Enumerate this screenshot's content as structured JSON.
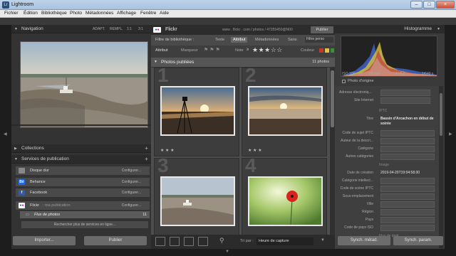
{
  "window": {
    "title": "Lightroom",
    "min": "–",
    "max": "□",
    "close": "×"
  },
  "menu": [
    "Fichier",
    "Édition",
    "Bibliothèque",
    "Photo",
    "Métadonnées",
    "Affichage",
    "Fenêtre",
    "Aide"
  ],
  "navigator": {
    "title": "Navigation",
    "options": [
      "ADAPT.",
      "REMPL.",
      "1:1",
      "3:1"
    ]
  },
  "collections": {
    "title": "Collections",
    "add": "+"
  },
  "publish": {
    "title": "Services de publication",
    "add": "+",
    "services": [
      {
        "icon": "",
        "name": "Disque dur",
        "action": "Configurer..."
      },
      {
        "icon": "Bē",
        "name": "Behance",
        "action": "Configurer..."
      },
      {
        "icon": "f",
        "name": "Facebook",
        "action": "Configurer..."
      },
      {
        "icon": "••",
        "name": "Flickr",
        "sub": ": ma publication",
        "action": "Configurer..."
      }
    ],
    "photostream": {
      "name": "Flux de photos",
      "count": "11"
    },
    "find_more": "Rechercher plus de services en ligne..."
  },
  "left_buttons": {
    "import": "Importer...",
    "publish": "Publier"
  },
  "center": {
    "service_title": "Flickr",
    "url": "www . flickr . com / photos / 47355450@N00",
    "publish_btn": "Publier",
    "filter_label": "Filtre de bibliothèque :",
    "filter_tabs": [
      "Texte",
      "Attribut",
      "Métadonnées",
      "Sans"
    ],
    "preset": "Filtre perso",
    "attribute_label": "Attribut",
    "flag_label": "Marqueur",
    "rating_label": "Note",
    "rating_op": "≥",
    "rating_stars": "★ ★ ★ ☆ ☆",
    "color_label": "Couleur",
    "grid_title": "Photos publiées",
    "grid_count": "11 photos",
    "cells": [
      {
        "num": "1",
        "stars": "★ ★ ★"
      },
      {
        "num": "2",
        "stars": "★ ★ ★"
      },
      {
        "num": "3",
        "stars": "★ ★ ★"
      },
      {
        "num": "4",
        "stars": "★ ★ ★"
      }
    ],
    "sort_label": "Tri par :",
    "sort_value": "Heure de capture"
  },
  "right": {
    "histogram_title": "Histogramme",
    "hist_info": [
      "ISO 100",
      "50 mm",
      "f / 5,6",
      "1/640 s"
    ],
    "original_label": "Photo d'origine",
    "meta_top": [
      "Adresse électroniq...",
      "Site Internet"
    ],
    "iptc_header": "IPTC",
    "title_key": "Titre",
    "title_value": "Bassin d'Arcachon en début de soirée",
    "iptc_fields": [
      "Code de sujet IPTC",
      "Auteur de la descri...",
      "Catégorie",
      "Autres catégories"
    ],
    "image_header": "Image",
    "date_key": "Date de création",
    "date_value": "2019-04-20T19:04:58.00",
    "image_fields": [
      "Catégorie intellect...",
      "Code de scène IPTC",
      "Sous-emplacement",
      "Ville",
      "Région",
      "Pays",
      "Code de pays ISO"
    ],
    "rights_header": "Flux de droit",
    "sync_meta": "Synch. métad.",
    "sync_settings": "Synch. param."
  },
  "colors": {
    "accent_flickr_blue": "#0063dc",
    "accent_flickr_pink": "#ff0084",
    "behance": "#1769ff",
    "facebook": "#3b5998",
    "panel": "#333333"
  }
}
